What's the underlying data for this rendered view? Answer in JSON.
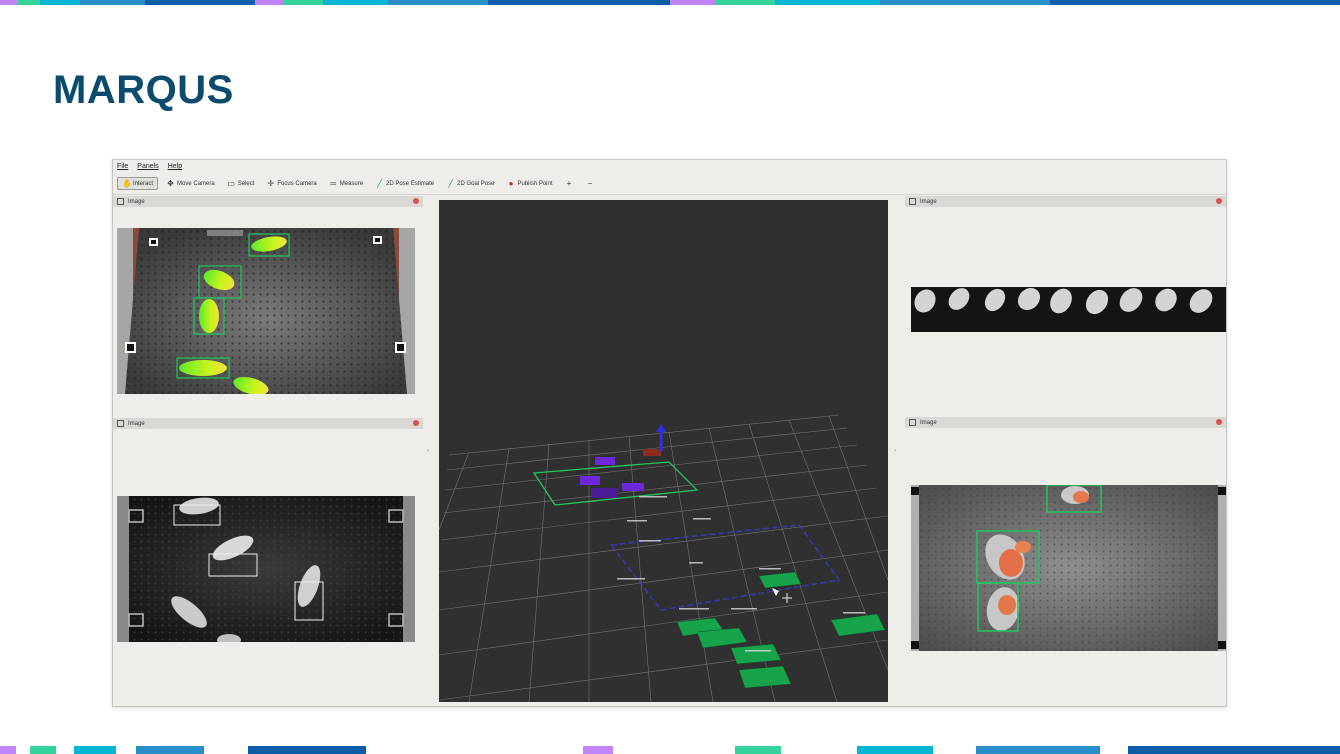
{
  "slide": {
    "title": "MARQUS"
  },
  "colors": {
    "title": "#0c4a6e",
    "stripe_purple": "#c084fc",
    "stripe_green": "#34d399",
    "stripe_cyan": "#06b6d4",
    "stripe_blue": "#2a8fc8",
    "stripe_navy": "#0b5da8",
    "viewport_bg": "#303030",
    "detection_green": "#22c55e"
  },
  "window": {
    "menu": [
      "File",
      "Panels",
      "Help"
    ],
    "toolbar": [
      {
        "label": "Interact",
        "icon": "hand-icon",
        "active": true
      },
      {
        "label": "Move Camera",
        "icon": "move-camera-icon"
      },
      {
        "label": "Select",
        "icon": "select-icon"
      },
      {
        "label": "Focus Camera",
        "icon": "focus-camera-icon"
      },
      {
        "label": "Measure",
        "icon": "measure-icon"
      },
      {
        "label": "2D Pose Estimate",
        "icon": "pose-estimate-icon"
      },
      {
        "label": "2D Goal Pose",
        "icon": "goal-pose-icon"
      },
      {
        "label": "Publish Point",
        "icon": "publish-point-icon"
      }
    ],
    "panels": {
      "top_left": "Image",
      "bottom_left": "Image",
      "top_right": "Image",
      "bottom_right": "Image"
    }
  }
}
